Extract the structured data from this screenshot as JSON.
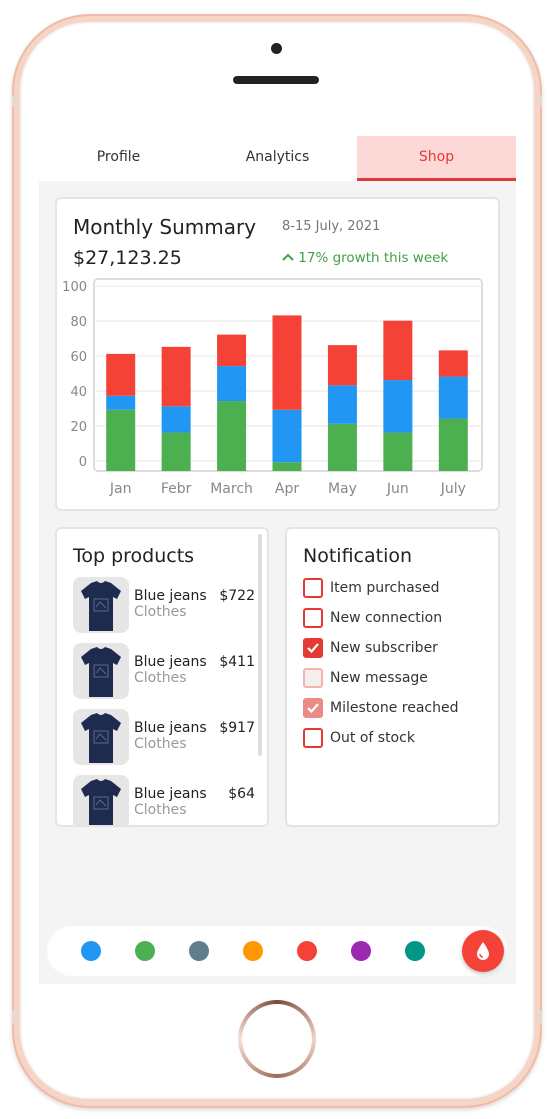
{
  "tabs": [
    {
      "label": "Profile",
      "active": false
    },
    {
      "label": "Analytics",
      "active": false
    },
    {
      "label": "Shop",
      "active": true
    }
  ],
  "summary": {
    "title": "Monthly Summary",
    "date_range": "8-15 July, 2021",
    "amount": "$27,123.25",
    "growth": "17% growth this week"
  },
  "chart_data": {
    "type": "bar",
    "stacked": true,
    "categories": [
      "Jan",
      "Febr",
      "March",
      "Apr",
      "May",
      "Jun",
      "July"
    ],
    "series": [
      {
        "values": [
          35,
          22,
          40,
          5,
          27,
          22,
          30
        ],
        "color": "#4caf50"
      },
      {
        "values": [
          8,
          15,
          20,
          30,
          22,
          30,
          24
        ],
        "color": "#2196f3"
      },
      {
        "values": [
          24,
          34,
          18,
          54,
          23,
          34,
          15
        ],
        "color": "#f44336"
      }
    ],
    "y_ticks": [
      "100",
      "80",
      "60",
      "40",
      "20",
      "0"
    ],
    "ylim": [
      0,
      100
    ],
    "grid": true
  },
  "products": {
    "title": "Top products",
    "items": [
      {
        "name": "Blue jeans",
        "category": "Clothes",
        "price": "$722"
      },
      {
        "name": "Blue jeans",
        "category": "Clothes",
        "price": "$411"
      },
      {
        "name": "Blue jeans",
        "category": "Clothes",
        "price": "$917"
      },
      {
        "name": "Blue jeans",
        "category": "Clothes",
        "price": "$64"
      }
    ]
  },
  "notifications": {
    "title": "Notification",
    "items": [
      {
        "label": "Item purchased",
        "checked": false,
        "disabled": false
      },
      {
        "label": "New connection",
        "checked": false,
        "disabled": false
      },
      {
        "label": "New subscriber",
        "checked": true,
        "disabled": false
      },
      {
        "label": "New message",
        "checked": false,
        "disabled": true
      },
      {
        "label": "Milestone reached",
        "checked": true,
        "disabled": true
      },
      {
        "label": "Out of stock",
        "checked": false,
        "disabled": false
      }
    ]
  },
  "colors": {
    "accent": "#e53935",
    "swatches": [
      "#2196f3",
      "#4caf50",
      "#607d8b",
      "#ff9800",
      "#f44336",
      "#9c27b0",
      "#009688"
    ],
    "fab_icon": "water-drop-icon"
  }
}
